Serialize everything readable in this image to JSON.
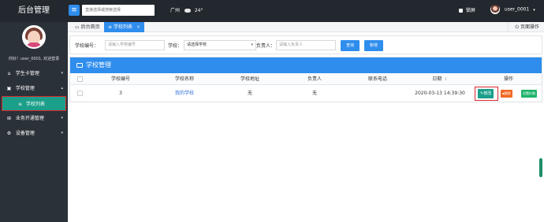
{
  "app": {
    "title": "后台管理"
  },
  "topbar": {
    "search_placeholder": "直接选择或搜索选择",
    "city": "广州",
    "temperature": "24°",
    "lock_label": "锁屏",
    "username": "user_0001",
    "caret": "▾",
    "menu_icon": "menu-icon",
    "weather_icon": "cloud-icon",
    "lock_icon": "lock-icon"
  },
  "sidebar": {
    "greeting": "你好！user_0001, 欢迎登录",
    "items": [
      {
        "label": "学生卡管理",
        "icon": "home-icon",
        "glyph": "⌂",
        "arrow": "▾"
      },
      {
        "label": "学校管理",
        "icon": "school-icon",
        "glyph": "▣",
        "arrow": "▴"
      },
      {
        "label": "学校列表",
        "icon": "list-icon",
        "glyph": "≡",
        "active": true
      },
      {
        "label": "业务开通管理",
        "icon": "grid-icon",
        "glyph": "⊞",
        "arrow": "▾"
      },
      {
        "label": "设备管理",
        "icon": "gears-icon",
        "glyph": "⚙",
        "arrow": "▾"
      }
    ],
    "active_color": "#1c9f8a",
    "highlight_border": "#d9262c"
  },
  "tabs": {
    "home_label": "后台首页",
    "active_label": "学校列表",
    "close_glyph": "×",
    "page_ops_label": "页面操作"
  },
  "filter": {
    "code_label": "学校编号：",
    "code_placeholder": "请输入学校编号",
    "school_label": "学校：",
    "school_value": "请选择学校",
    "owner_label": "负责人：",
    "owner_placeholder": "请输入负责人",
    "query_button": "查询",
    "add_button": "新增"
  },
  "panel": {
    "title": "学校管理",
    "columns": [
      "学校编号",
      "学校名称",
      "学校地址",
      "负责人",
      "联系电话",
      "日期",
      "操作"
    ],
    "sort_glyph": "⇕",
    "rows": [
      {
        "code": "3",
        "name": "我的学校",
        "address": "无",
        "owner": "无",
        "phone": "",
        "date": "2020-03-13 14:39:30",
        "actions": {
          "edit": "修改",
          "delete": "删除",
          "price": "设置价格"
        }
      }
    ]
  },
  "colors": {
    "primary": "#2f8ded",
    "sidebar": "#2b3138",
    "topbar": "#22282e",
    "edit": "#1c9f8a",
    "delete": "#f26a25",
    "price": "#1fb369"
  }
}
